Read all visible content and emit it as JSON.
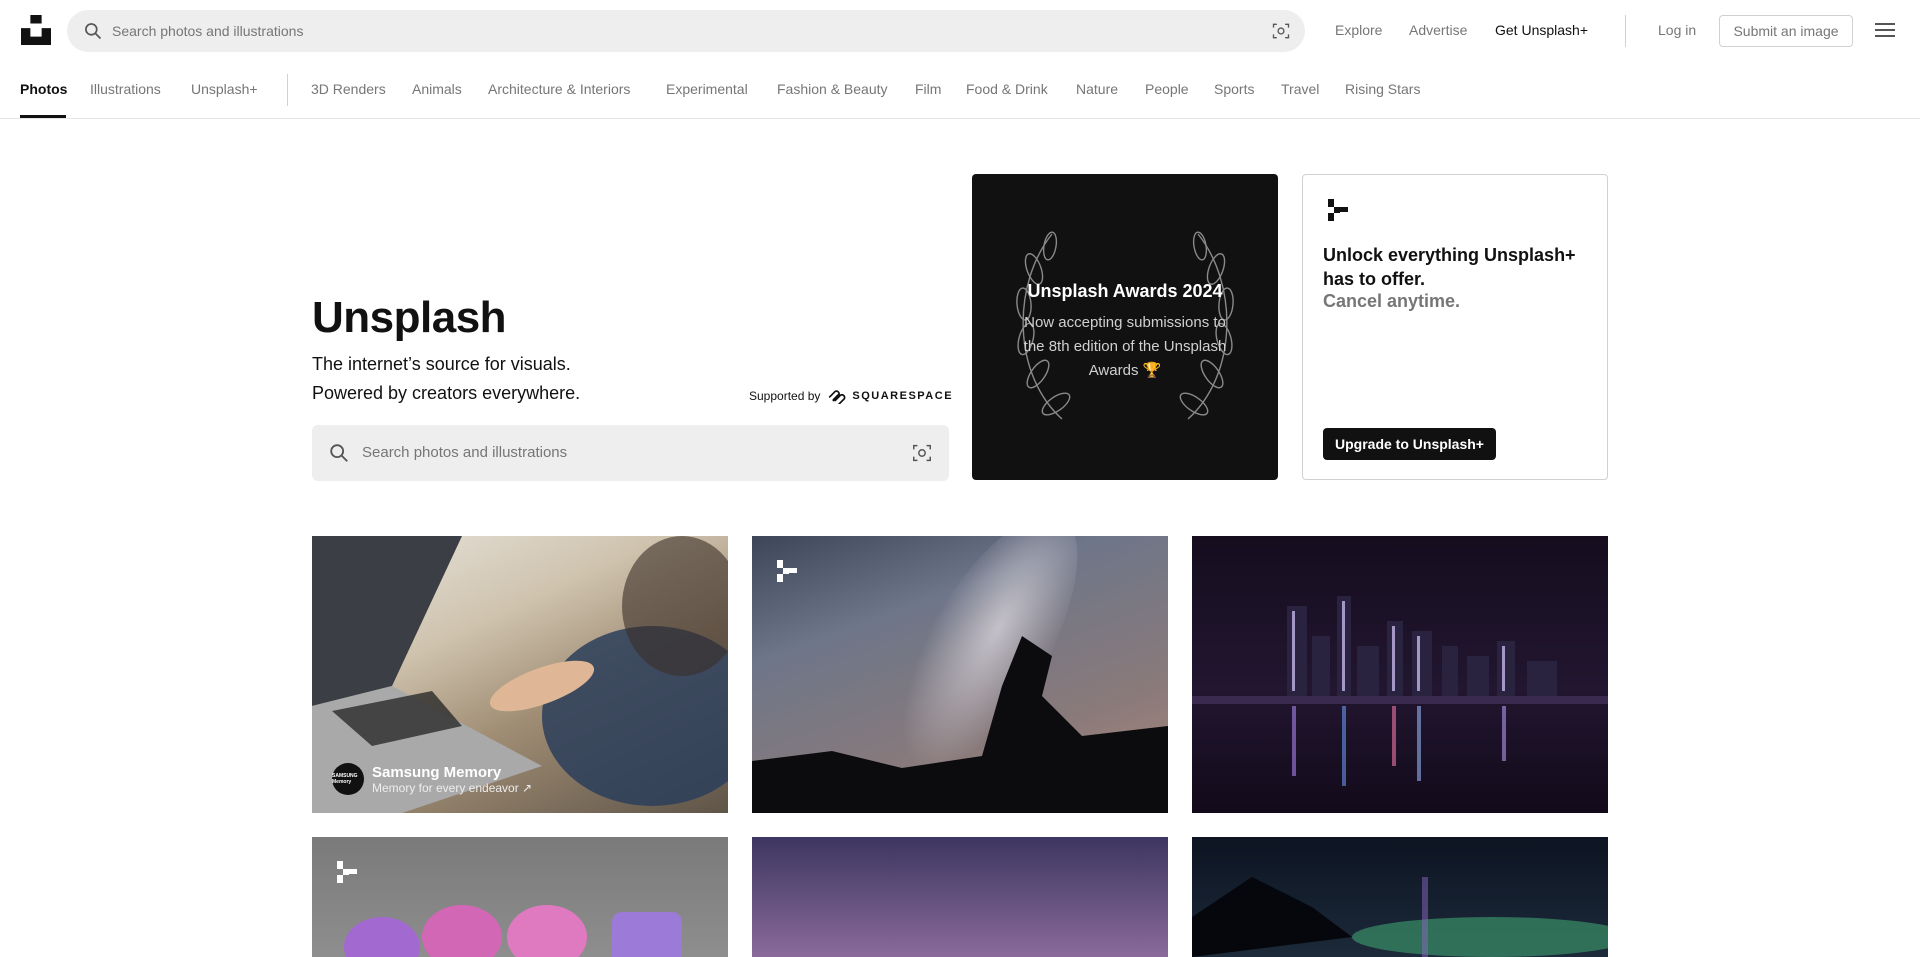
{
  "header": {
    "search_placeholder": "Search photos and illustrations",
    "nav": {
      "explore": "Explore",
      "advertise": "Advertise",
      "get_plus": "Get Unsplash+",
      "login": "Log in",
      "submit": "Submit an image"
    }
  },
  "tabs": {
    "primary": [
      "Photos",
      "Illustrations",
      "Unsplash+"
    ],
    "categories": [
      "3D Renders",
      "Animals",
      "Architecture & Interiors",
      "Experimental",
      "Fashion & Beauty",
      "Film",
      "Food & Drink",
      "Nature",
      "People",
      "Sports",
      "Travel",
      "Rising Stars"
    ]
  },
  "hero": {
    "title": "Unsplash",
    "line1": "The internet’s source for visuals.",
    "line2": "Powered by creators everywhere.",
    "supported_by": "Supported by",
    "sponsor_name": "SQUARESPACE",
    "search_placeholder": "Search photos and illustrations"
  },
  "awards": {
    "title": "Unsplash Awards 2024",
    "text": "Now accepting submissions to the 8th edition of the Unsplash Awards 🏆"
  },
  "plus_card": {
    "title": "Unlock everything Unsplash+ has to offer.",
    "subtitle": "Cancel anytime.",
    "button": "Upgrade to Unsplash+"
  },
  "photos": {
    "sponsored": {
      "name": "Samsung Memory",
      "tagline": "Memory for every endeavor ↗",
      "avatar_text": "SAMSUNG Memory"
    }
  },
  "colors": {
    "text_primary": "#111111",
    "text_secondary": "#767676",
    "search_bg": "#eeeeee",
    "border": "#d1d1d1"
  }
}
